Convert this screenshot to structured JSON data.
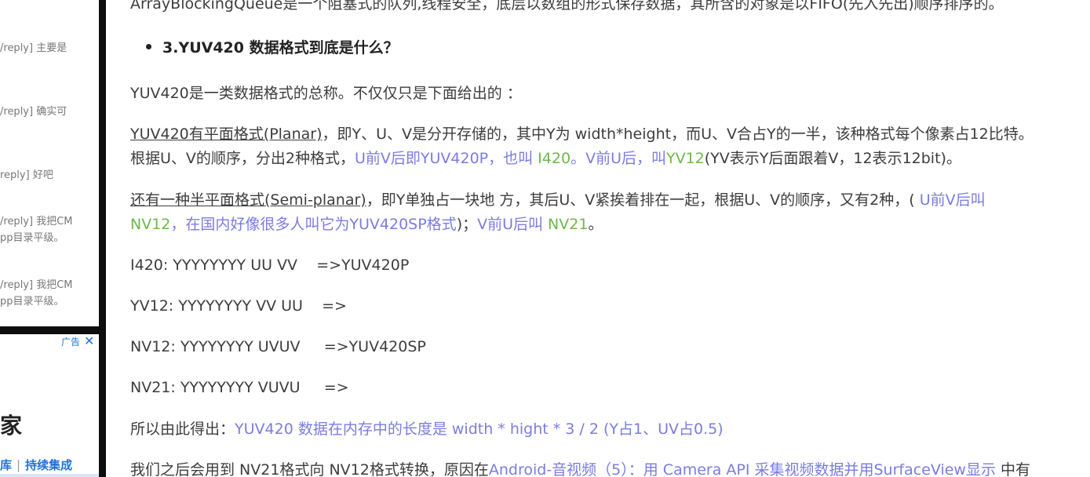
{
  "sidebar": {
    "comments": [
      "/reply] 主要是",
      "/reply] 确实可",
      "reply] 好吧",
      "/reply] 我把CM",
      "pp目录平级。",
      "/reply] 我把CM",
      "pp目录平级。"
    ],
    "ad": {
      "label": "广告",
      "close": "✕",
      "heading": "家",
      "link1": "库",
      "separator": "|",
      "link2": "持续集成"
    }
  },
  "article": {
    "top_line": "ArrayBlockingQueue是一个阻塞式的队列,线程安全，底层以数组的形式保存数据，其所含的对象是以FIFO(先入先出)顺序排序的。",
    "bullet": "3.YUV420 数据格式到底是什么？",
    "p1": "YUV420是一类数据格式的总称。不仅仅只是下面给出的 ：",
    "p2": {
      "a_underlined": "YUV420有平面格式(Planar)",
      "a_rest": "，即Y、U、V是分开存储的，其中Y为 width*height，而U、V合占Y的一半，该种格式每个像素占12比特。",
      "b1": "根据U、V的顺序，分出2种格式，",
      "b2": "U前V后即YUV420P，也叫",
      "b3": " I420",
      "b4": "。",
      "b5": "V前U后，叫",
      "b6": "YV12",
      "b7": "(YV表示Y后面跟着V，12表示12bit)。"
    },
    "p3": {
      "a_underlined": "还有一种半平面格式(Semi-planar)",
      "a_rest": "，即Y单独占一块地 方，其后U、V紧挨着排在一起，根据U、V的顺序，又有2种，(",
      "a_blue": " U前V后叫",
      "b1": "NV12",
      "b2": "，在国内好像很多人叫它为YUV420SP格式",
      "b3": ")；",
      "b4": "V前U后叫",
      "b5": " NV21",
      "b6": "。"
    },
    "formats": [
      "I420: YYYYYYYY UU VV    =>YUV420P",
      "YV12: YYYYYYYY VV UU    =>",
      "NV12: YYYYYYYY UVUV     =>YUV420SP",
      "NV21: YYYYYYYY VUVU     =>"
    ],
    "p4": {
      "a": "所以由此得出：",
      "b": "YUV420 数据在内存中的长度是 width * hight * 3 / 2 (Y占1、UV占0.5)"
    },
    "p5": {
      "a": "我们之后会用到 NV21格式向 NV12格式转换，原因在",
      "link": "Android-音视频（5）：用 Camera API 采集视频数据并用SurfaceView显示",
      "b": " 中有"
    }
  }
}
